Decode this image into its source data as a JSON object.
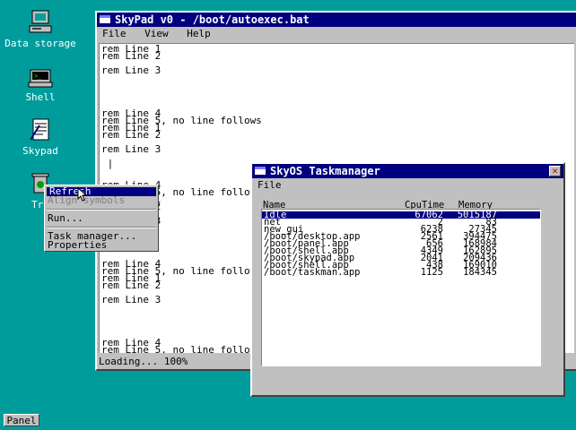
{
  "desktop": {
    "icons": [
      {
        "label": "Data storage",
        "icon": "computer-icon"
      },
      {
        "label": "Shell",
        "icon": "shell-icon"
      },
      {
        "label": "Skypad",
        "icon": "notepad-icon"
      },
      {
        "label": "Tra",
        "icon": "trash-icon"
      }
    ]
  },
  "skypad": {
    "title": "SkyPad v0 - /boot/autoexec.bat",
    "menu": [
      "File",
      "View",
      "Help"
    ],
    "text": "rem Line 1\nrem Line 2\n\nrem Line 3\n\n\n\n\n\nrem Line 4\nrem Line 5, no line follows\nrem Line 1\nrem Line 2\n\nrem Line 3\n\n |\n\n\nrem Line 4\nrem Line 5, no line follows\nrem Line 1\nrem Line 2\n\nrem Line 3\n\n\n\n\n\nrem Line 4\nrem Line 5, no line follows\nrem Line 1\nrem Line 2\n\nrem Line 3\n\n\n\n\n\nrem Line 4\nrem Line 5, no line follows\nrem Line 1\nrem Line 2",
    "status": "Loading... 100%"
  },
  "context_menu": {
    "items": [
      {
        "label": "Refresh",
        "state": "selected"
      },
      {
        "label": "Align symbols",
        "state": "disabled"
      },
      {
        "label": "Run...",
        "state": "normal"
      },
      {
        "label": "Task manager...",
        "state": "normal"
      },
      {
        "label": "Properties",
        "state": "normal"
      }
    ]
  },
  "taskmanager": {
    "title": "SkyOS Taskmanager",
    "menu": [
      "File"
    ],
    "columns": [
      "Name",
      "CpuTime",
      "Memory"
    ],
    "rows": [
      {
        "name": "Idle",
        "cpu": "67062",
        "mem": "5015187",
        "selected": true
      },
      {
        "name": "net",
        "cpu": "2",
        "mem": "83",
        "selected": false
      },
      {
        "name": "new_gui",
        "cpu": "6238",
        "mem": "27345",
        "selected": false
      },
      {
        "name": "/boot/desktop.app",
        "cpu": "2561",
        "mem": "394475",
        "selected": false
      },
      {
        "name": "/boot/panel.app",
        "cpu": "656",
        "mem": "168984",
        "selected": false
      },
      {
        "name": "/boot/shell.app",
        "cpu": "4349",
        "mem": "162895",
        "selected": false
      },
      {
        "name": "/boot/skypad.app",
        "cpu": "2041",
        "mem": "209436",
        "selected": false
      },
      {
        "name": "/boot/shell.app",
        "cpu": "438",
        "mem": "169010",
        "selected": false
      },
      {
        "name": "/boot/taskman.app",
        "cpu": "1125",
        "mem": "184345",
        "selected": false
      }
    ]
  },
  "taskbar": {
    "panel_label": "Panel"
  }
}
